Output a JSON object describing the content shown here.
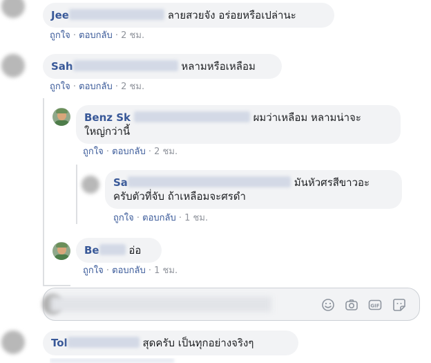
{
  "comments": [
    {
      "name": "Jee",
      "text": "ลายสวยจัง อร่อยหรือเปล่านะ",
      "like": "ถูกใจ",
      "reply": "ตอบกลับ",
      "time": "2 ชม."
    },
    {
      "name": "Sah",
      "text": "หลามหรือเหลือม",
      "like": "ถูกใจ",
      "reply": "ตอบกลับ",
      "time": "2 ชม."
    },
    {
      "name": "Benz Sk",
      "text": "ผมว่าเหลือม หลามน่าจะ",
      "text2": "ใหญ่กว่านี้",
      "like": "ถูกใจ",
      "reply": "ตอบกลับ",
      "time": "2 ชม."
    },
    {
      "name": "Sa",
      "text": "มันหัวศรสีขาวอะ",
      "text2": "ครับตัวที่จับ ถ้าเหลือมจะศรดำ",
      "like": "ถูกใจ",
      "reply": "ตอบกลับ",
      "time": "1 ชม."
    },
    {
      "name": "Be",
      "text": "อ่อ",
      "like": "ถูกใจ",
      "reply": "ตอบกลับ",
      "time": "1 ชม."
    },
    {
      "name": "Tol",
      "text": "สุดครับ เป็นทุกอย่างจริงๆ"
    }
  ],
  "separator": "·",
  "composer_icons": [
    "emoji-icon",
    "camera-icon",
    "gif-icon",
    "sticker-icon"
  ],
  "colors": {
    "name": "#385898",
    "bubble": "#f2f3f5",
    "meta": "#90949c"
  }
}
